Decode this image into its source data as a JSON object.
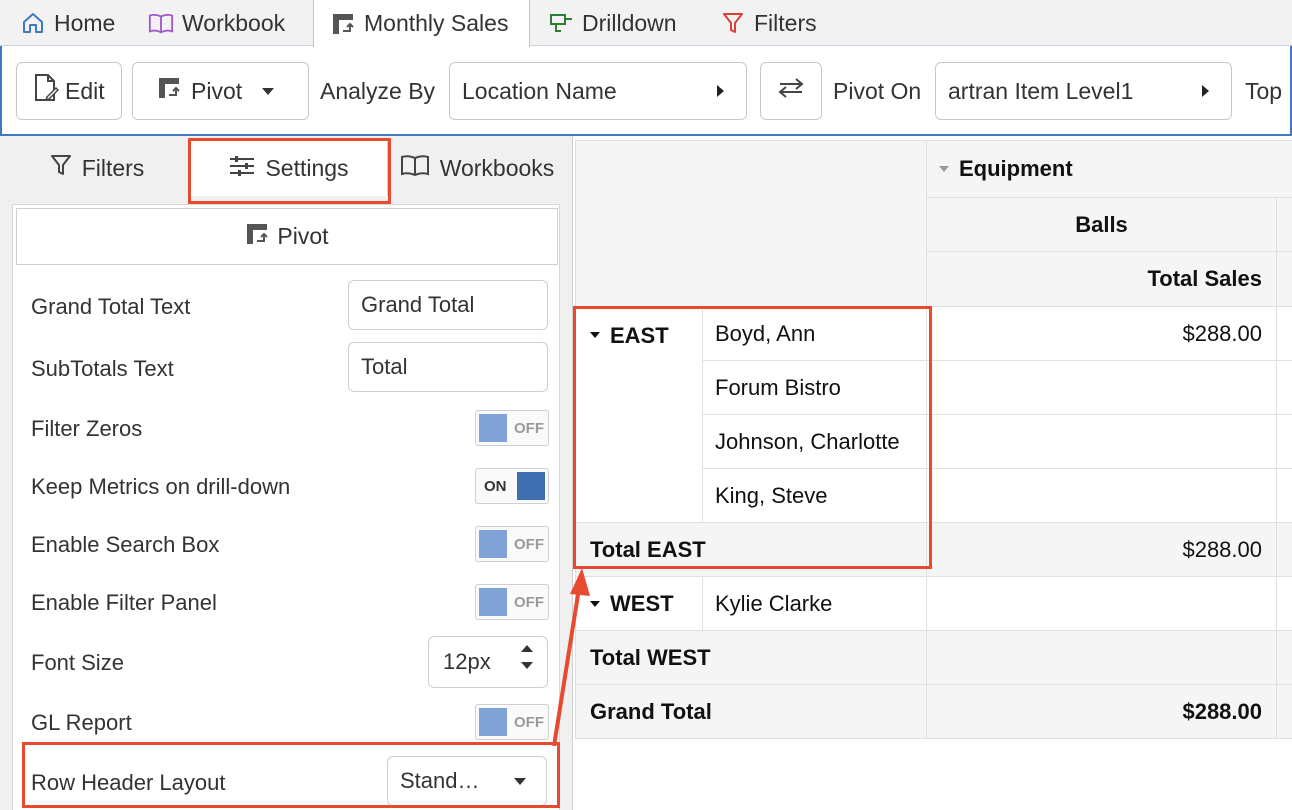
{
  "tabs": [
    {
      "label": "Home"
    },
    {
      "label": "Workbook"
    },
    {
      "label": "Monthly Sales"
    },
    {
      "label": "Drilldown"
    },
    {
      "label": "Filters"
    }
  ],
  "toolbar": {
    "edit_label": "Edit",
    "pivot_label": "Pivot",
    "analyze_by_label": "Analyze By",
    "analyze_by_value": "Location Name",
    "pivot_on_label": "Pivot On",
    "pivot_on_value": "artran Item Level1",
    "top_label": "Top"
  },
  "left_panel": {
    "tabs": [
      "Filters",
      "Settings",
      "Workbooks"
    ],
    "section_title": "Pivot",
    "settings": {
      "grand_total_text": {
        "label": "Grand Total Text",
        "value": "Grand Total"
      },
      "subtotals_text": {
        "label": "SubTotals Text",
        "value": "Total"
      },
      "filter_zeros": {
        "label": "Filter Zeros",
        "state": "OFF"
      },
      "keep_metrics": {
        "label": "Keep Metrics on drill-down",
        "state": "ON"
      },
      "enable_search_box": {
        "label": "Enable Search Box",
        "state": "OFF"
      },
      "enable_filter_panel": {
        "label": "Enable Filter Panel",
        "state": "OFF"
      },
      "font_size": {
        "label": "Font Size",
        "value": "12px"
      },
      "gl_report": {
        "label": "GL Report",
        "state": "OFF"
      },
      "row_header_layout": {
        "label": "Row Header Layout",
        "value": "Stand…"
      }
    }
  },
  "grid": {
    "col_group": "Equipment",
    "col_sub": "Balls",
    "measure": "Total Sales",
    "east_label": "EAST",
    "east_rows": [
      {
        "name": "Boyd, Ann",
        "value": "$288.00"
      },
      {
        "name": "Forum Bistro",
        "value": ""
      },
      {
        "name": "Johnson, Charlotte",
        "value": ""
      },
      {
        "name": "King, Steve",
        "value": ""
      }
    ],
    "total_east_label": "Total EAST",
    "total_east_value": "$288.00",
    "west_label": "WEST",
    "west_rows": [
      {
        "name": "Kylie Clarke",
        "value": ""
      }
    ],
    "total_west_label": "Total WEST",
    "total_west_value": "",
    "grand_total_label": "Grand Total",
    "grand_total_value": "$288.00"
  },
  "colors": {
    "accent": "#3f79c4",
    "annotation": "#e84a2f",
    "toggle_off": "#7fa3d6",
    "toggle_on": "#3f6fb0"
  }
}
